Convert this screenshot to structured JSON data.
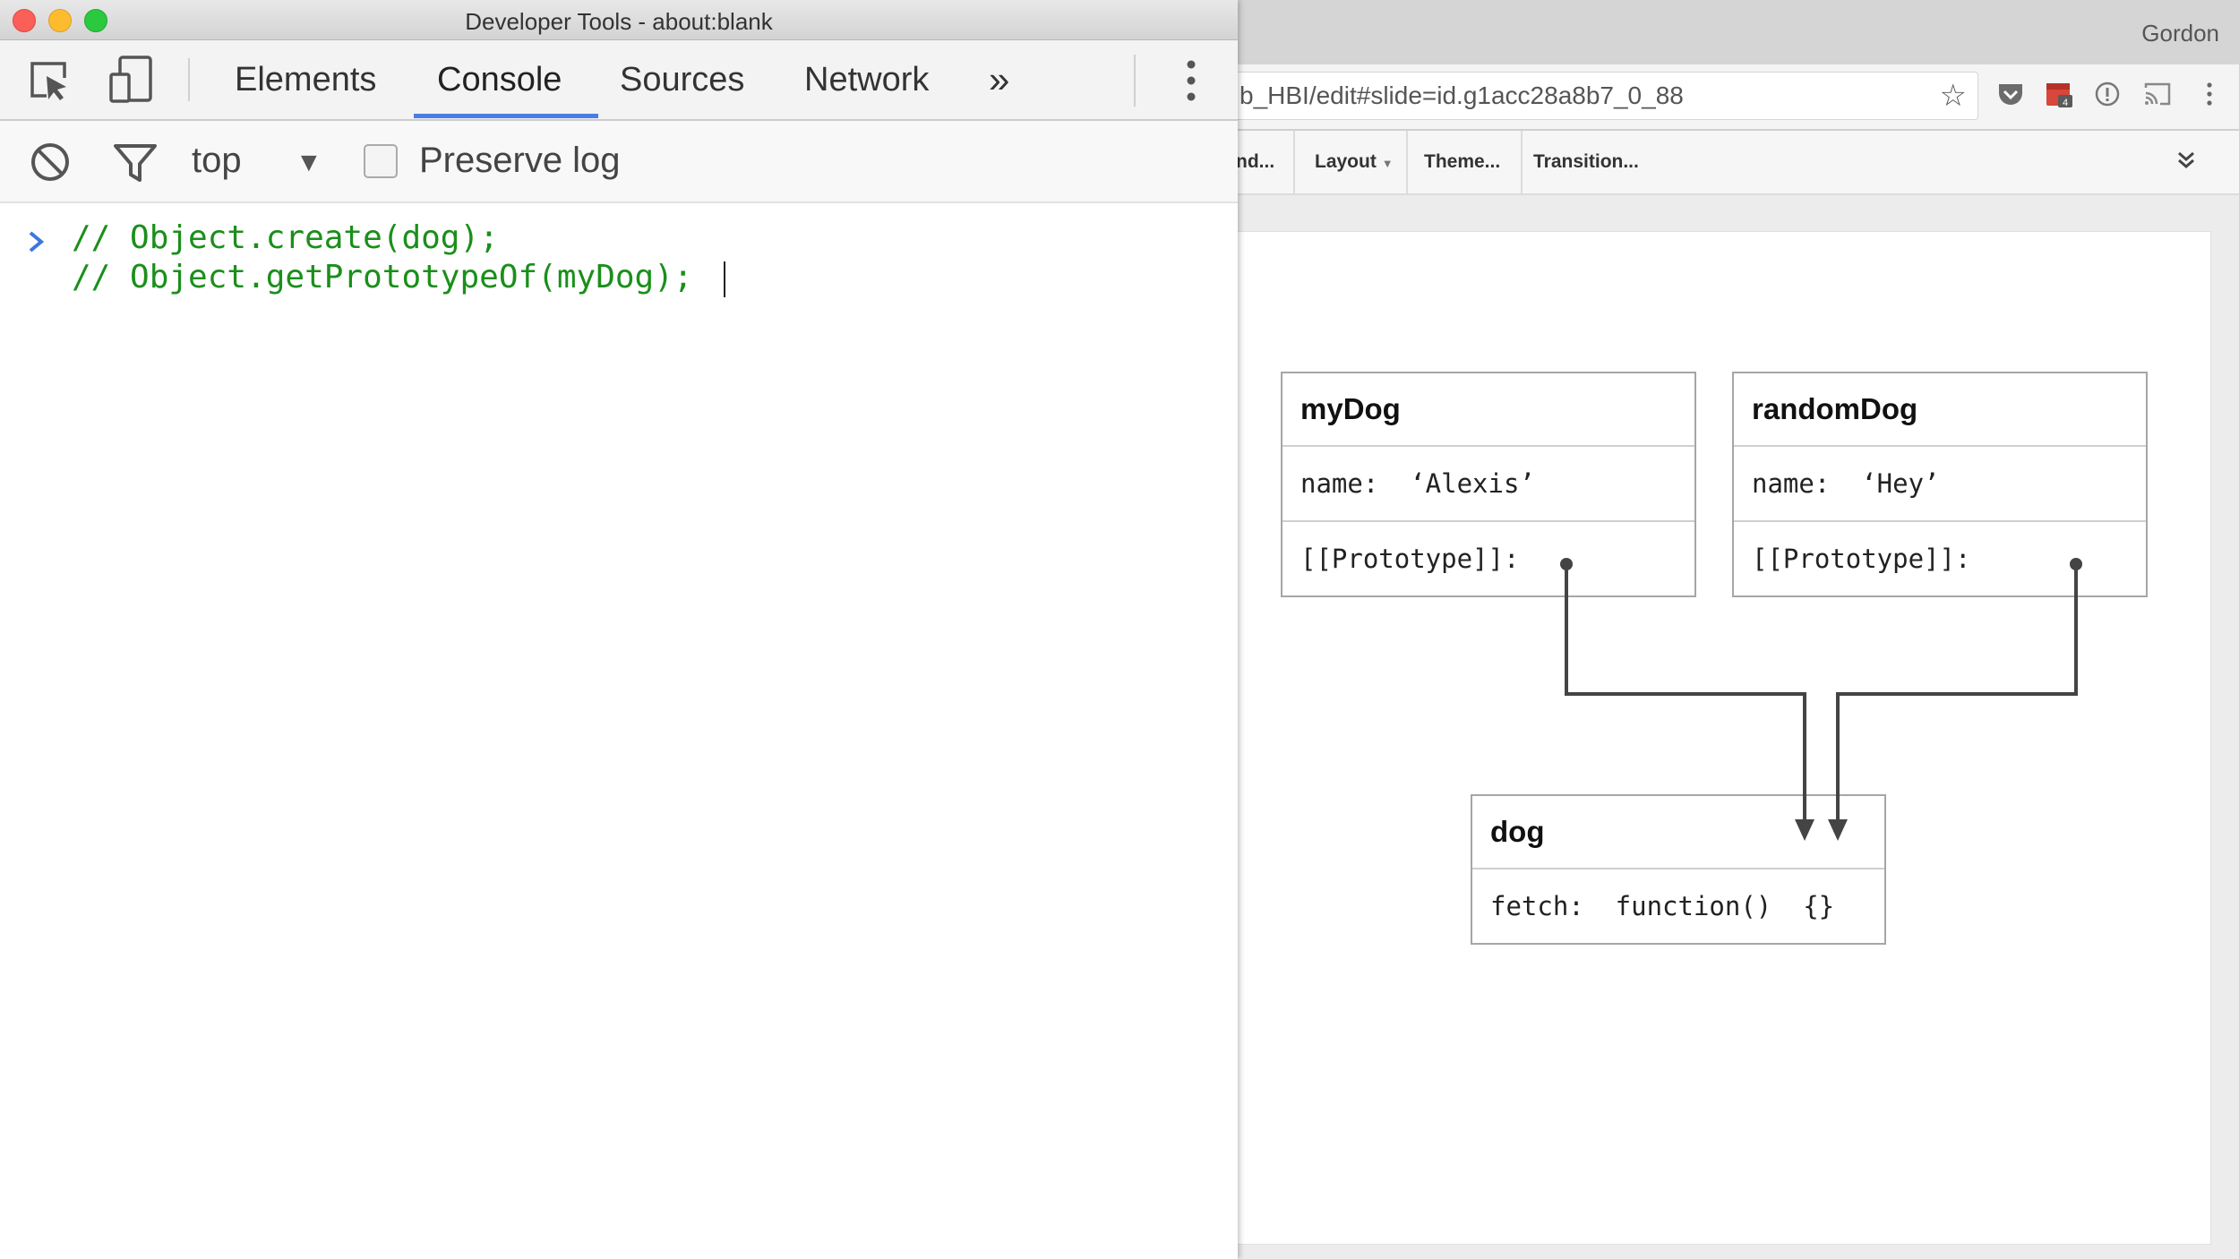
{
  "browser": {
    "user_name": "Gordon",
    "url": "b_HBI/edit#slide=id.g1acc28a8b7_0_88",
    "menubar": {
      "items": [
        "nd...",
        "Layout",
        "Theme...",
        "Transition..."
      ]
    }
  },
  "slide": {
    "objects": [
      {
        "title": "myDog",
        "rows": [
          "name:  ‘Alexis’",
          "[[Prototype]]:"
        ]
      },
      {
        "title": "randomDog",
        "rows": [
          "name:  ‘Hey’",
          "[[Prototype]]:"
        ]
      },
      {
        "title": "dog",
        "rows": [
          "fetch:  function()  {}"
        ]
      }
    ]
  },
  "devtools": {
    "window_title": "Developer Tools - about:blank",
    "tabs": [
      "Elements",
      "Console",
      "Sources",
      "Network"
    ],
    "active_tab": "Console",
    "context": "top",
    "preserve_log_label": "Preserve log",
    "preserve_log_checked": false,
    "console_lines": [
      "// Object.create(dog);",
      "// Object.getPrototypeOf(myDog);"
    ]
  },
  "colors": {
    "accent": "#4a7ee6",
    "console_code": "#1a8f1a",
    "traffic_close": "#fc5f57",
    "traffic_minimize": "#fdbc2e",
    "traffic_zoom": "#2ac940"
  },
  "icons": [
    "inspect-icon",
    "device-toolbar-icon",
    "more-tabs-icon",
    "kebab-menu-icon",
    "clear-console-icon",
    "filter-icon",
    "dropdown-arrow-icon",
    "console-prompt-icon",
    "star-icon",
    "pocket-icon",
    "calendar-extension-icon",
    "info-icon",
    "cast-icon",
    "browser-menu-icon",
    "collapse-icon"
  ]
}
